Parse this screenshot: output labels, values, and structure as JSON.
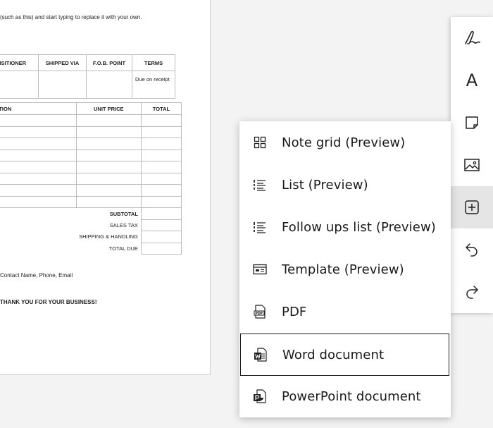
{
  "document": {
    "intro_text": "(such as this) and start typing to replace it with your own.",
    "shipping_table": {
      "headers": [
        "REQUISITIONER",
        "SHIPPED VIA",
        "F.O.B. POINT",
        "TERMS"
      ],
      "row": [
        "",
        "",
        "",
        "Due on receipt"
      ]
    },
    "items_table": {
      "headers": [
        "DESCRIPTION",
        "UNIT PRICE",
        "TOTAL"
      ],
      "empty_rows": 8,
      "totals": [
        "SUBTOTAL",
        "SALES TAX",
        "SHIPPING & HANDLING",
        "TOTAL DUE"
      ]
    },
    "contact_text": "Contact Name, Phone, Email",
    "thanks_text": "THANK YOU FOR YOUR BUSINESS!"
  },
  "toolbar": {
    "tools": [
      {
        "name": "pen",
        "icon": "pen-icon"
      },
      {
        "name": "text",
        "label": "A",
        "icon": "text-icon"
      },
      {
        "name": "sticky-note",
        "icon": "sticky-note-icon"
      },
      {
        "name": "image",
        "icon": "image-icon"
      },
      {
        "name": "insert",
        "icon": "insert-plus-icon",
        "active": true
      },
      {
        "name": "undo",
        "icon": "undo-icon"
      },
      {
        "name": "redo",
        "icon": "redo-icon"
      }
    ]
  },
  "insert_menu": {
    "items": [
      {
        "label": "Note grid (Preview)",
        "icon": "note-grid-icon"
      },
      {
        "label": "List (Preview)",
        "icon": "list-icon"
      },
      {
        "label": "Follow ups list (Preview)",
        "icon": "follow-ups-list-icon"
      },
      {
        "label": "Template (Preview)",
        "icon": "template-icon"
      },
      {
        "label": "PDF",
        "icon": "pdf-icon"
      },
      {
        "label": "Word document",
        "icon": "word-icon",
        "focused": true
      },
      {
        "label": "PowerPoint document",
        "icon": "powerpoint-icon"
      }
    ]
  },
  "colors": {
    "background": "#f3f3f3",
    "surface": "#ffffff",
    "active_tool": "#e5e5e5",
    "text": "#1a1a1a",
    "focus_border": "#1a1a1a"
  }
}
